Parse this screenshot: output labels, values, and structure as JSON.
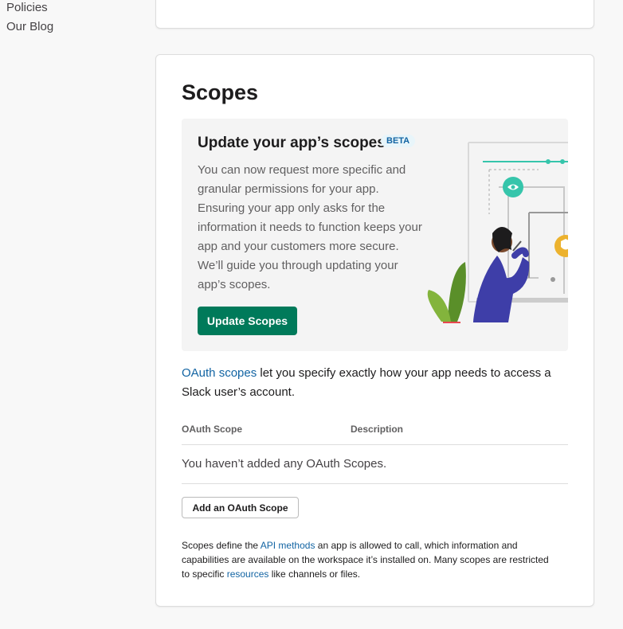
{
  "sidebar": {
    "items": [
      {
        "label": "Policies"
      },
      {
        "label": "Our Blog"
      }
    ]
  },
  "scopes_section": {
    "title": "Scopes",
    "promo": {
      "title": "Update your app’s scopes",
      "badge": "BETA",
      "body": "You can now request more specific and granular permissions for your app. Ensuring your app only asks for the information it needs to function keeps your app and your customers more secure. We’ll guide you through updating your app’s scopes.",
      "button_label": "Update Scopes"
    },
    "intro": {
      "link_text": "OAuth scopes",
      "text": " let you specify exactly how your app needs to access a Slack user’s account."
    },
    "table": {
      "columns": [
        "OAuth Scope",
        "Description"
      ],
      "empty_message": "You haven’t added any OAuth Scopes."
    },
    "add_button_label": "Add an OAuth Scope",
    "footnote": {
      "part1": "Scopes define the ",
      "link1": "API methods",
      "part2": " an app is allowed to call, which information and capabilities are available on the workspace it’s installed on. Many scopes are restricted to specific ",
      "link2": "resources",
      "part3": " like channels or files."
    }
  },
  "colors": {
    "primary_button": "#007a5a",
    "link": "#1264a3",
    "illustration_teal": "#36c5ab",
    "illustration_purple": "#3e3ea8",
    "illustration_yellow": "#ecb22e",
    "illustration_green": "#5a8f29"
  },
  "icons": [
    "eye-icon",
    "shield-icon"
  ]
}
